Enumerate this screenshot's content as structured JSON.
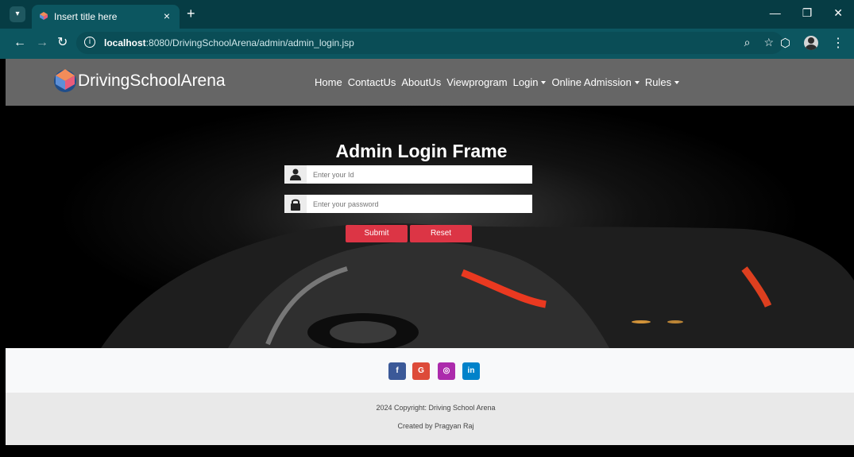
{
  "browser": {
    "tab_title": "Insert title here",
    "url_host": "localhost",
    "url_path": ":8080/DrivingSchoolArena/admin/admin_login.jsp",
    "close_symbol": "×",
    "new_tab_symbol": "+"
  },
  "site": {
    "brand": "DrivingSchoolArena",
    "menu": [
      {
        "label": "Home",
        "dropdown": false
      },
      {
        "label": "ContactUs",
        "dropdown": false
      },
      {
        "label": "AboutUs",
        "dropdown": false
      },
      {
        "label": "Viewprogram",
        "dropdown": false
      },
      {
        "label": "Login",
        "dropdown": true
      },
      {
        "label": "Online Admission",
        "dropdown": true
      },
      {
        "label": "Rules",
        "dropdown": true
      }
    ]
  },
  "login": {
    "title": "Admin Login Frame",
    "id_placeholder": "Enter your Id",
    "password_placeholder": "Enter your password",
    "submit_label": "Submit",
    "reset_label": "Reset"
  },
  "social": [
    {
      "icon": "facebook-icon",
      "glyph": "f",
      "color": "#3b5998"
    },
    {
      "icon": "google-icon",
      "glyph": "G",
      "color": "#dd4b39"
    },
    {
      "icon": "instagram-icon",
      "glyph": "◎",
      "color": "#ac2bac"
    },
    {
      "icon": "linkedin-icon",
      "glyph": "in",
      "color": "#0082ca"
    }
  ],
  "footer": {
    "copyright": "2024 Copyright: Driving School Arena",
    "credit": "Created by Pragyan Raj"
  },
  "colors": {
    "accent": "#dc3545",
    "nav_bg": "#666666",
    "chrome_bg": "#0c5660"
  }
}
